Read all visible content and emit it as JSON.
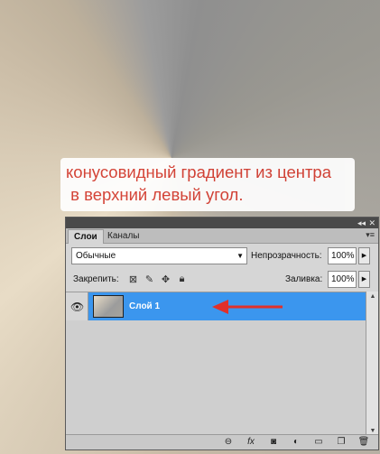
{
  "annotation": {
    "line1": "конусовидный градиент из центра",
    "line2": " в верхний левый угол."
  },
  "panel": {
    "titlebar": {
      "collapse_icon": "double-chevron-left-icon",
      "close_icon": "close-icon"
    },
    "tabs": [
      {
        "label": "Слои",
        "active": true
      },
      {
        "label": "Каналы",
        "active": false
      }
    ],
    "menu_icon": "panel-menu-icon",
    "blend_mode": "Обычные",
    "opacity_label": "Непрозрачность:",
    "opacity_value": "100%",
    "lock_label": "Закрепить:",
    "lock_icons": [
      "lock-transparent-icon",
      "lock-pixels-icon",
      "lock-position-icon",
      "lock-all-icon"
    ],
    "fill_label": "Заливка:",
    "fill_value": "100%",
    "layers": [
      {
        "name": "Слой 1",
        "visible": true,
        "selected": true
      }
    ],
    "footer_icons": [
      "link-icon",
      "fx-icon",
      "mask-icon",
      "adjustment-icon",
      "group-folder-icon",
      "new-layer-icon",
      "trash-icon"
    ],
    "colors": {
      "selection": "#3b96ee",
      "annotation_text": "#d43a2e",
      "arrow": "#e0302a"
    }
  }
}
